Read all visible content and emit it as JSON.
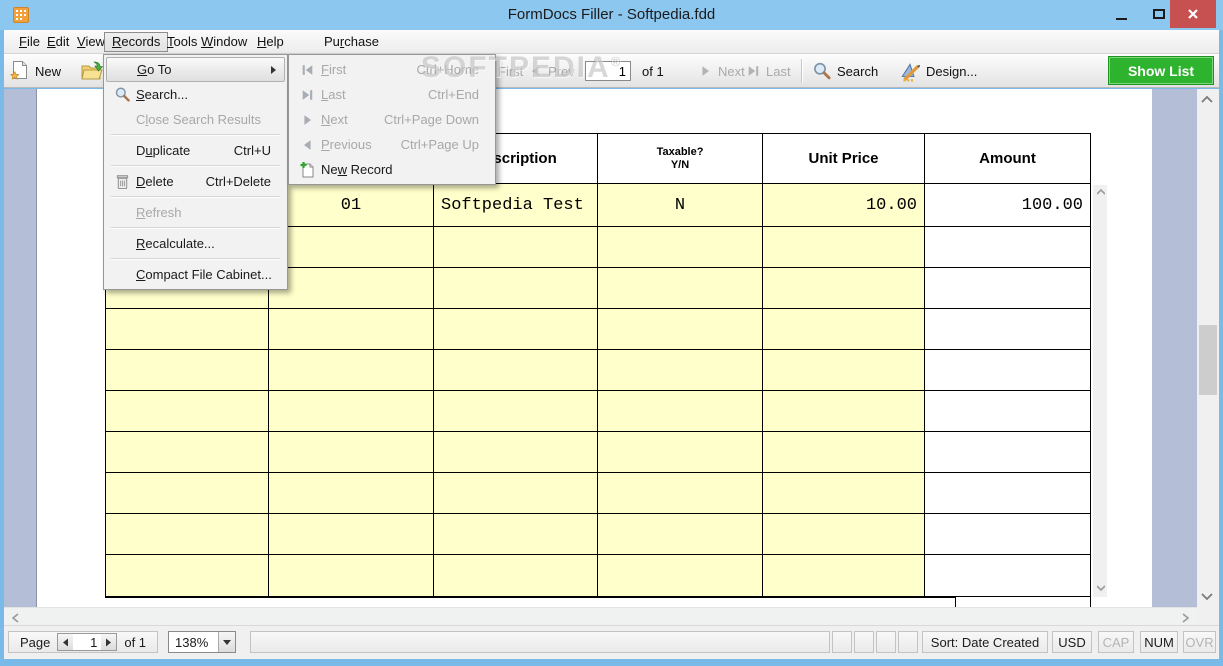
{
  "window": {
    "title": "FormDocs Filler - Softpedia.fdd"
  },
  "menu_bar": {
    "items": [
      {
        "label": "&File"
      },
      {
        "label": "&Edit"
      },
      {
        "label": "&View"
      },
      {
        "label": "&Records"
      },
      {
        "label": "&Tools"
      },
      {
        "label": "&Window"
      },
      {
        "label": "&Help"
      },
      {
        "label": "Pu&rchase"
      }
    ]
  },
  "records_menu": {
    "items": [
      {
        "label": "&Go To",
        "shortcut": ""
      },
      {
        "label": "&Search...",
        "shortcut": ""
      },
      {
        "label": "C&lose Search Results",
        "shortcut": ""
      },
      {
        "label": "D&uplicate",
        "shortcut": "Ctrl+U"
      },
      {
        "label": "&Delete",
        "shortcut": "Ctrl+Delete"
      },
      {
        "label": "&Refresh",
        "shortcut": ""
      },
      {
        "label": "&Recalculate...",
        "shortcut": ""
      },
      {
        "label": "&Compact File Cabinet...",
        "shortcut": ""
      }
    ]
  },
  "goto_submenu": {
    "items": [
      {
        "label": "&First",
        "shortcut": "Ctrl+Home"
      },
      {
        "label": "&Last",
        "shortcut": "Ctrl+End"
      },
      {
        "label": "&Next",
        "shortcut": "Ctrl+Page Down"
      },
      {
        "label": "&Previous",
        "shortcut": "Ctrl+Page Up"
      },
      {
        "label": "Ne&w Record",
        "shortcut": ""
      }
    ]
  },
  "toolbar": {
    "new_label": "New",
    "first_label": "First",
    "prev_label": "Prev",
    "record_value": "1",
    "of_label": "of 1",
    "next_label": "Next",
    "last_label": "Last",
    "search_label": "Search",
    "design_label": "Design...",
    "show_list_label": "Show List"
  },
  "form_table": {
    "headers": {
      "col1": "",
      "col2": "",
      "col3": "Description",
      "col4_line1": "Taxable?",
      "col4_line2": "Y/N",
      "col5": "Unit Price",
      "col6": "Amount"
    },
    "row1": {
      "col1": "",
      "col2": "01",
      "col3": "Softpedia Test",
      "col4": "N",
      "col5": "10.00",
      "col6": "100.00"
    },
    "empty_row_count": 9
  },
  "status_bar": {
    "page_label": "Page",
    "page_value": "1",
    "of_label": "of 1",
    "zoom_value": "138%",
    "sort_label": "Sort: Date Created",
    "currency": "USD",
    "cap": "CAP",
    "num": "NUM",
    "ovr": "OVR"
  },
  "watermark": {
    "text": "SOFTPEDIA",
    "reg": "®"
  },
  "colors": {
    "titlebar_blue": "#8cc7f0",
    "border_blue": "#79bae9",
    "close_red": "#c75050",
    "accent_green": "#2db32d",
    "field_yellow": "#ffffcb",
    "band_blue": "#b4bfd7"
  }
}
